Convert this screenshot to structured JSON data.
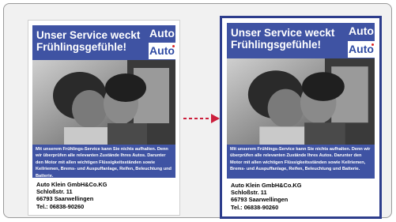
{
  "flyer": {
    "headline": "Unser Service weckt\nFrühlingsgefühle!",
    "logo_top": "Auto",
    "logo_bottom": "Auto",
    "body": "Mit unserem Frühlings-Service kann Sie nichts aufhalten. Denn wir überprüfen alle relevanten Zustände Ihres Autos. Darunter den Motor mit allen wichtigen Flüssigkeitsständen sowie Keilriemen, Brems- und Auspuffanlage, Reifen, Beleuchtung und Batterie.",
    "address": {
      "company": "Auto Klein GmbH&Co.KG",
      "street": "Schloßstr. 11",
      "city": "66793 Saarwellingen",
      "phone": "Tel.: 06838-90260"
    }
  },
  "colors": {
    "brand_blue": "#3f53a3",
    "selection_border": "#2d3d8c",
    "arrow_red": "#cc1f3c"
  }
}
